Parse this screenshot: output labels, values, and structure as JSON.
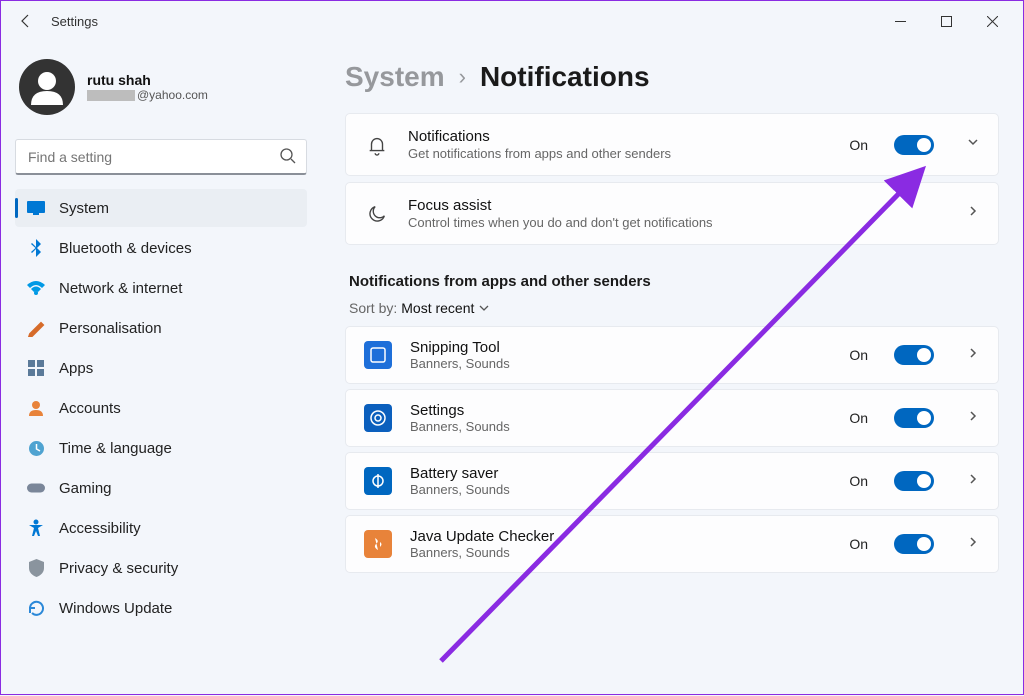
{
  "window": {
    "title": "Settings"
  },
  "profile": {
    "name": "rutu shah",
    "email_domain": "@yahoo.com"
  },
  "search": {
    "placeholder": "Find a setting"
  },
  "nav_items": [
    {
      "label": "System",
      "icon_color": "#0078d4",
      "selected": true
    },
    {
      "label": "Bluetooth & devices",
      "icon_color": "#0078d4"
    },
    {
      "label": "Network & internet",
      "icon_color": "#0099e5"
    },
    {
      "label": "Personalisation",
      "icon_color": "#d66b2a"
    },
    {
      "label": "Apps",
      "icon_color": "#5b7a99"
    },
    {
      "label": "Accounts",
      "icon_color": "#e8833a"
    },
    {
      "label": "Time & language",
      "icon_color": "#4fa3d1"
    },
    {
      "label": "Gaming",
      "icon_color": "#7a8699"
    },
    {
      "label": "Accessibility",
      "icon_color": "#0078d4"
    },
    {
      "label": "Privacy & security",
      "icon_color": "#8a949e"
    },
    {
      "label": "Windows Update",
      "icon_color": "#2b88d8"
    }
  ],
  "breadcrumb": {
    "parent": "System",
    "current": "Notifications"
  },
  "cards": {
    "notifications": {
      "title": "Notifications",
      "subtitle": "Get notifications from apps and other senders",
      "state": "On"
    },
    "focus": {
      "title": "Focus assist",
      "subtitle": "Control times when you do and don't get notifications"
    }
  },
  "section_header": "Notifications from apps and other senders",
  "sort": {
    "label": "Sort by:",
    "value": "Most recent"
  },
  "apps": [
    {
      "name": "Snipping Tool",
      "subtitle": "Banners, Sounds",
      "state": "On",
      "bg": "#1e6fd9"
    },
    {
      "name": "Settings",
      "subtitle": "Banners, Sounds",
      "state": "On",
      "bg": "#0b5fbd"
    },
    {
      "name": "Battery saver",
      "subtitle": "Banners, Sounds",
      "state": "On",
      "bg": "#0067c0"
    },
    {
      "name": "Java Update Checker",
      "subtitle": "Banners, Sounds",
      "state": "On",
      "bg": "#e8833a"
    }
  ],
  "annotation": {
    "color": "#8a2be2"
  }
}
